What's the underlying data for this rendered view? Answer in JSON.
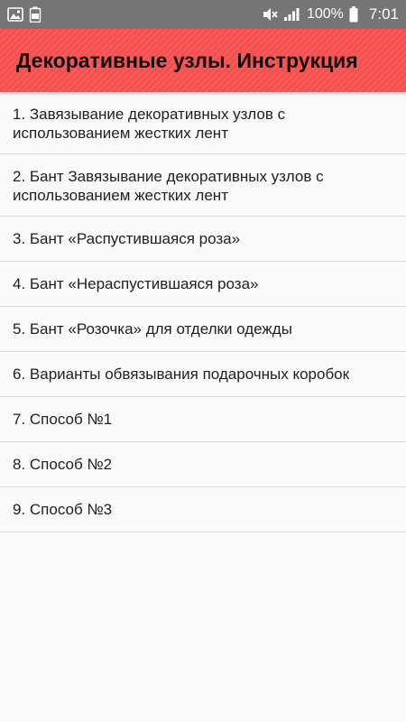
{
  "status_bar": {
    "battery_percent": "100%",
    "time": "7:01",
    "icons": [
      "image-icon",
      "battery-saver-icon",
      "mute-icon",
      "signal-icon",
      "battery-icon"
    ]
  },
  "app_bar": {
    "title": "Декоративные узлы. Инструкция",
    "color": "#f4504f"
  },
  "items": [
    {
      "label": "1. Завязывание декоративных узлов с использованием жестких лент"
    },
    {
      "label": "2. Бант Завязывание декоративных узлов с использованием жестких лент"
    },
    {
      "label": "3. Бант «Распустившаяся роза»"
    },
    {
      "label": "4. Бант «Нераспустившаяся роза»"
    },
    {
      "label": "5. Бант «Розочка» для отделки одежды"
    },
    {
      "label": "6. Варианты обвязывания подарочных коробок"
    },
    {
      "label": "7. Способ №1"
    },
    {
      "label": "8. Способ №2"
    },
    {
      "label": "9. Способ №3"
    }
  ]
}
